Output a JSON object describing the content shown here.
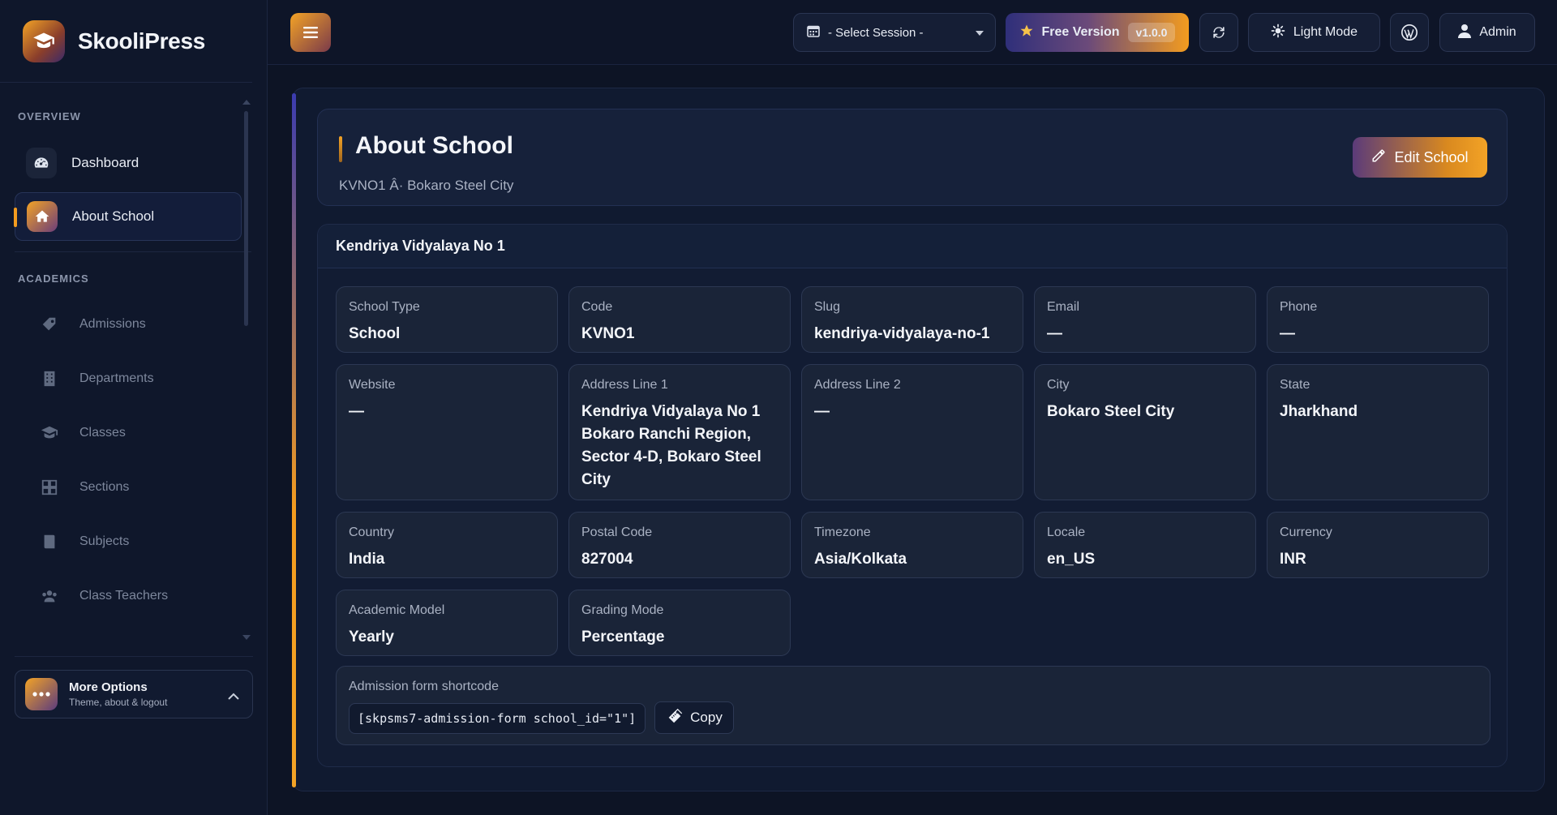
{
  "brand": {
    "name": "SkooliPress"
  },
  "sidebar": {
    "sections": {
      "overview": "OVERVIEW",
      "academics": "ACADEMICS"
    },
    "items": [
      {
        "label": "Dashboard",
        "icon": "gauge-icon"
      },
      {
        "label": "About School",
        "icon": "home-icon",
        "active": true
      },
      {
        "label": "Admissions",
        "icon": "tag-icon"
      },
      {
        "label": "Departments",
        "icon": "building-icon"
      },
      {
        "label": "Classes",
        "icon": "graduation-cap-icon"
      },
      {
        "label": "Sections",
        "icon": "grid-icon"
      },
      {
        "label": "Subjects",
        "icon": "book-icon"
      },
      {
        "label": "Class Teachers",
        "icon": "users-icon"
      }
    ],
    "more_options": {
      "title": "More Options",
      "subtitle": "Theme, about & logout"
    }
  },
  "topbar": {
    "session_label": "- Select Session -",
    "free_version": "Free Version",
    "version": "v1.0.0",
    "light_mode": "Light Mode",
    "admin": "Admin"
  },
  "header": {
    "title": "About School",
    "subtitle": "KVNO1 Â· Bokaro Steel City",
    "edit_label": "Edit School"
  },
  "school": {
    "name": "Kendriya Vidyalaya No 1",
    "fields": [
      {
        "label": "School Type",
        "value": "School"
      },
      {
        "label": "Code",
        "value": "KVNO1"
      },
      {
        "label": "Slug",
        "value": "kendriya-vidyalaya-no-1"
      },
      {
        "label": "Email",
        "value": "—"
      },
      {
        "label": "Phone",
        "value": "—"
      },
      {
        "label": "Website",
        "value": "—"
      },
      {
        "label": "Address Line 1",
        "value": "Kendriya Vidyalaya No 1 Bokaro Ranchi Region, Sector 4-D, Bokaro Steel City"
      },
      {
        "label": "Address Line 2",
        "value": "—"
      },
      {
        "label": "City",
        "value": "Bokaro Steel City"
      },
      {
        "label": "State",
        "value": "Jharkhand"
      },
      {
        "label": "Country",
        "value": "India"
      },
      {
        "label": "Postal Code",
        "value": "827004"
      },
      {
        "label": "Timezone",
        "value": "Asia/Kolkata"
      },
      {
        "label": "Locale",
        "value": "en_US"
      },
      {
        "label": "Currency",
        "value": "INR"
      },
      {
        "label": "Academic Model",
        "value": "Yearly"
      },
      {
        "label": "Grading Mode",
        "value": "Percentage"
      }
    ],
    "shortcode": {
      "label": "Admission form shortcode",
      "code": "[skpsms7-admission-form school_id=\"1\"]",
      "copy_label": "Copy"
    }
  },
  "colors": {
    "accent": "#f39c1f",
    "background": "#0d1425",
    "card": "#1a2438"
  }
}
